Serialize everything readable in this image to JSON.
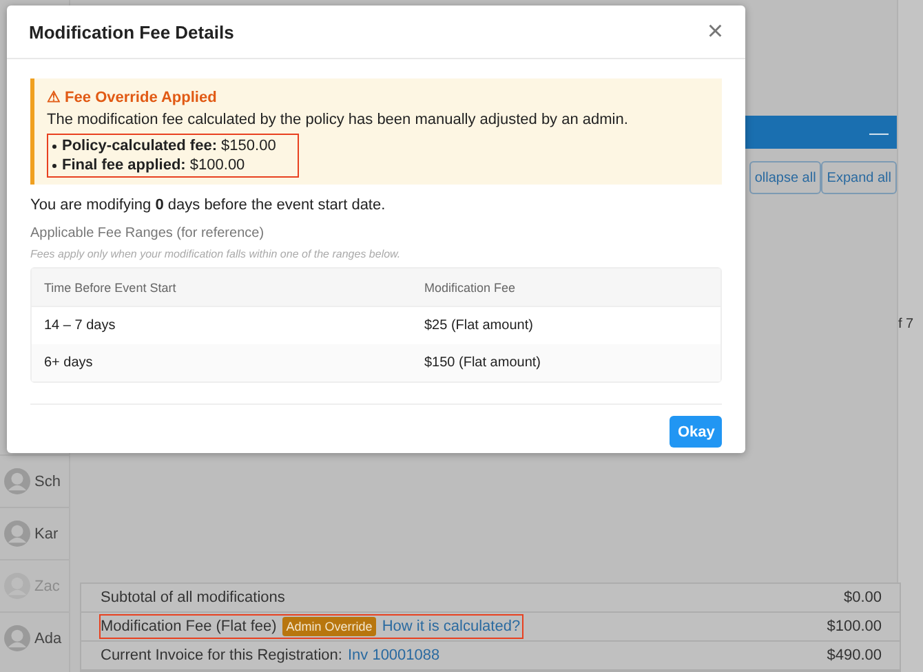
{
  "people": [
    {
      "name": "Sch",
      "dimmed": false
    },
    {
      "name": "Kar",
      "dimmed": false
    },
    {
      "name": "Zac",
      "dimmed": true
    },
    {
      "name": "Ada",
      "dimmed": false
    }
  ],
  "page_count": "f 7",
  "panel": {
    "collapse_symbol": "—",
    "buttons": [
      "ollapse all",
      "Expand all"
    ],
    "summary": [
      {
        "label": "Subtotal of all modifications",
        "amount": "$0.00",
        "highlighted": false
      },
      {
        "label": "Modification Fee (Flat fee)",
        "badge": "Admin Override",
        "link": "How it is calculated?",
        "amount": "$100.00",
        "highlighted": true
      },
      {
        "label": "Current Invoice for this Registration:",
        "link": "Inv 10001088",
        "amount": "$490.00",
        "highlighted": false
      }
    ]
  },
  "modal": {
    "title": "Modification Fee Details",
    "close": "×",
    "alert": {
      "title": "⚠ Fee Override Applied",
      "message": "The modification fee calculated by the policy has been manually adjusted by an admin.",
      "highlighted": true,
      "items": [
        "**Policy-calculated fee:** $150.00",
        "**Final fee applied:** $100.00"
      ]
    },
    "days_text": "You are modifying **0** days before the event start date.",
    "section_label": "Applicable Fee Ranges (for reference)",
    "hint": "Fees apply only when your modification falls within one of the ranges below.",
    "table": {
      "columns": [
        "Time Before Event Start",
        "Modification Fee"
      ],
      "rows": [
        [
          "14 – 7 days",
          "$25 (Flat amount)"
        ],
        [
          "6+ days",
          "$150 (Flat amount)"
        ]
      ]
    },
    "button": "Okay"
  }
}
